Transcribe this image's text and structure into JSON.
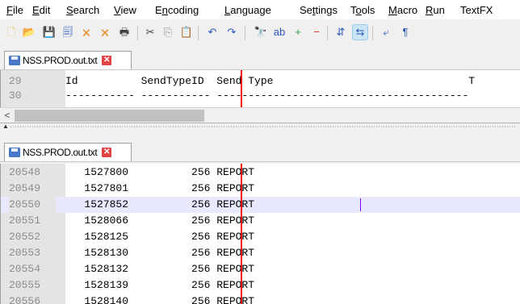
{
  "menu": [
    {
      "pre": "",
      "u": "F",
      "post": "ile"
    },
    {
      "pre": "",
      "u": "E",
      "post": "dit"
    },
    {
      "pre": "",
      "u": "S",
      "post": "earch"
    },
    {
      "pre": "",
      "u": "V",
      "post": "iew"
    },
    {
      "pre": "E",
      "u": "n",
      "post": "coding"
    },
    {
      "pre": "",
      "u": "L",
      "post": "anguage"
    },
    {
      "pre": "Se",
      "u": "t",
      "post": "tings"
    },
    {
      "pre": "T",
      "u": "o",
      "post": "ols"
    },
    {
      "pre": "",
      "u": "M",
      "post": "acro"
    },
    {
      "pre": "",
      "u": "R",
      "post": "un"
    },
    {
      "pre": "TextFX",
      "u": "",
      "post": ""
    }
  ],
  "toolbar": {
    "icons": [
      "new-file-icon",
      "open-file-icon",
      "save-icon",
      "save-all-icon",
      "close-icon",
      "close-all-icon",
      "print-icon",
      "cut-icon",
      "copy-icon",
      "paste-icon",
      "undo-icon",
      "redo-icon",
      "find-icon",
      "replace-icon",
      "zoom-in-icon",
      "zoom-out-icon",
      "sync-vertical-icon",
      "sync-horizontal-icon",
      "word-wrap-icon",
      "show-all-chars-icon"
    ],
    "glyphs": [
      "🗋",
      "📂",
      "💾",
      "🗐",
      "🗙",
      "🗙",
      "🖶",
      "✂",
      "⎘",
      "📋",
      "↶",
      "↷",
      "🔭",
      "ab",
      "+",
      "−",
      "⇵",
      "⇆",
      "⤶",
      "¶"
    ],
    "colors": [
      "#e8c46a",
      "#f0b830",
      "#2b58b8",
      "#2b58b8",
      "#e89030",
      "#e89030",
      "#404040",
      "#404040",
      "#909090",
      "#c08a3a",
      "#2b58b8",
      "#2b58b8",
      "#303030",
      "#2b58b8",
      "#2c9a3a",
      "#d03030",
      "#2b58b8",
      "#2b58b8",
      "#2b58b8",
      "#2b58b8"
    ]
  },
  "top_pane": {
    "tab_label": "NSS.PROD.out.txt",
    "lines": [
      {
        "num": "29",
        "text": "Id          SendTypeID  Send Type                               T"
      },
      {
        "num": "30",
        "text": "----------- ----------- ----------------------------------------"
      }
    ]
  },
  "bottom_pane": {
    "tab_label": "NSS.PROD.out.txt",
    "lines": [
      {
        "num": "20548",
        "text": "   1527800          256 REPORT"
      },
      {
        "num": "20549",
        "text": "   1527801          256 REPORT"
      },
      {
        "num": "20550",
        "text": "   1527852          256 REPORT"
      },
      {
        "num": "20551",
        "text": "   1528066          256 REPORT"
      },
      {
        "num": "20552",
        "text": "   1528125          256 REPORT"
      },
      {
        "num": "20553",
        "text": "   1528130          256 REPORT"
      },
      {
        "num": "20554",
        "text": "   1528132          256 REPORT"
      },
      {
        "num": "20555",
        "text": "   1528139          256 REPORT"
      },
      {
        "num": "20556",
        "text": "   1528140          256 REPORT"
      }
    ]
  },
  "hscroll": {
    "left_arrow": "<"
  },
  "colors": {
    "edge_line": "#ff0000",
    "current_line": "#e8e8ff",
    "caret": "#8000ff",
    "tab_close": "#e04343"
  }
}
